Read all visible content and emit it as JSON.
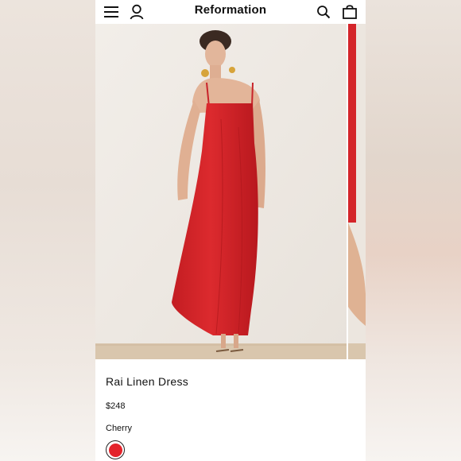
{
  "header": {
    "brand": "Reformation",
    "icons": [
      "menu-icon",
      "account-icon",
      "search-icon",
      "bag-icon"
    ]
  },
  "product": {
    "name": "Rai Linen Dress",
    "price": "$248",
    "color_name": "Cherry",
    "swatch_color": "#e3232b"
  },
  "colors": {
    "dress": "#d4252a",
    "backdrop": "#efebe6",
    "text": "#111111"
  }
}
